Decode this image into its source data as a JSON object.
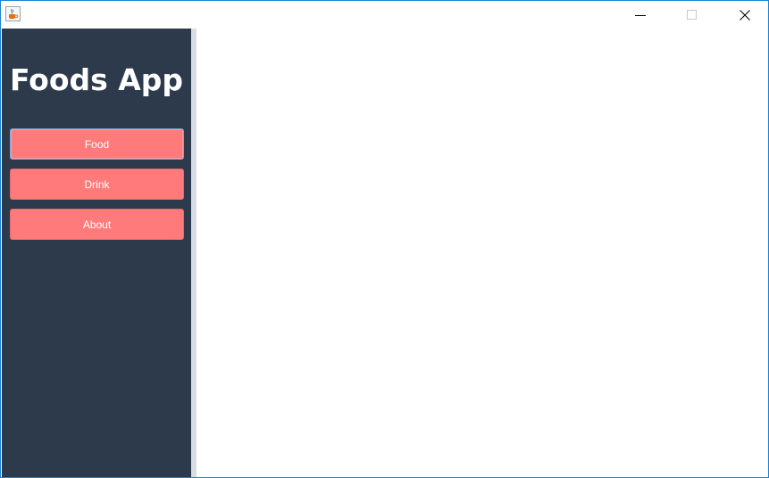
{
  "window": {
    "icon": "java-cup-icon",
    "controls": {
      "minimize": "minimize-icon",
      "maximize": "maximize-icon",
      "close": "close-icon"
    }
  },
  "sidebar": {
    "title": "Foods App",
    "background": "#2c3a4c",
    "items": [
      {
        "label": "Food",
        "focused": true
      },
      {
        "label": "Drink",
        "focused": false
      },
      {
        "label": "About",
        "focused": false
      }
    ],
    "button_color": "#ff7b7b"
  }
}
